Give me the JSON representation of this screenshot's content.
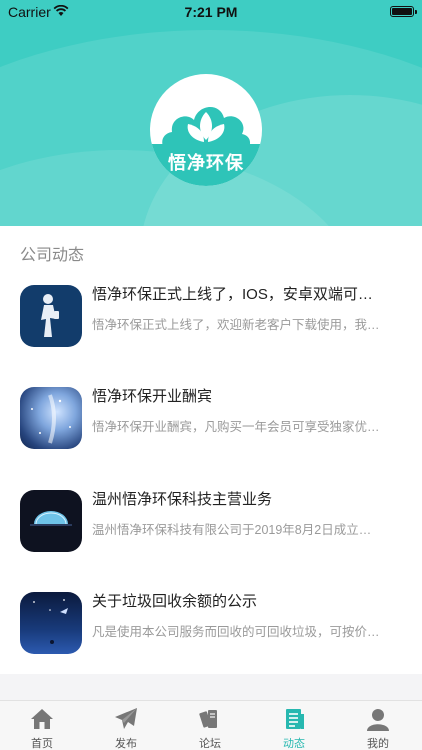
{
  "status_bar": {
    "carrier": "Carrier",
    "time": "7:21 PM"
  },
  "brand": {
    "logo_text": "悟净环保",
    "color": "#3ecdc3"
  },
  "section": {
    "title": "公司动态"
  },
  "news": [
    {
      "title": "悟净环保正式上线了，IOS，安卓双端可用…",
      "desc": "悟净环保正式上线了，欢迎新老客户下载使用，我…"
    },
    {
      "title": "悟净环保开业酬宾",
      "desc": "悟净环保开业酬宾，凡购买一年会员可享受独家优…"
    },
    {
      "title": "温州悟净环保科技主营业务",
      "desc": "温州悟净环保科技有限公司于2019年8月2日成立…"
    },
    {
      "title": "关于垃圾回收余额的公示",
      "desc": "凡是使用本公司服务而回收的可回收垃圾，可按价…"
    }
  ],
  "tabs": [
    {
      "label": "首页",
      "icon": "home-icon"
    },
    {
      "label": "发布",
      "icon": "paper-plane-icon"
    },
    {
      "label": "论坛",
      "icon": "books-icon"
    },
    {
      "label": "动态",
      "icon": "news-icon",
      "active": true
    },
    {
      "label": "我的",
      "icon": "person-icon"
    }
  ],
  "colors": {
    "accent": "#27b8b0",
    "inactive": "#555555"
  }
}
